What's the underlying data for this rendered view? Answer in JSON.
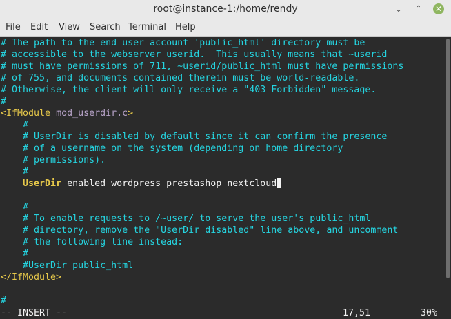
{
  "window": {
    "title": "root@instance-1:/home/rendy",
    "minimize_glyph": "⌄",
    "maximize_glyph": "⌃",
    "close_glyph": "✕"
  },
  "menu": [
    "File",
    "Edit",
    "View",
    "Search",
    "Terminal",
    "Help"
  ],
  "editor": {
    "lines": [
      "# The path to the end user account 'public_html' directory must be",
      "# accessible to the webserver userid.  This usually means that ~userid",
      "# must have permissions of 711, ~userid/public_html must have permissions",
      "# of 755, and documents contained therein must be world-readable.",
      "# Otherwise, the client will only receive a \"403 Forbidden\" message.",
      "#",
      "    #",
      "    # UserDir is disabled by default since it can confirm the presence",
      "    # of a username on the system (depending on home directory",
      "    # permissions).",
      "    #",
      "    #",
      "    # To enable requests to /~user/ to serve the user's public_html",
      "    # directory, remove the \"UserDir disabled\" line above, and uncomment",
      "    # the following line instead:",
      "    #",
      "    #UserDir public_html",
      "#"
    ],
    "ifmodule_open_bracket": "<IfModule",
    "ifmodule_name": "mod_userdir.c",
    "ifmodule_close_bracket": ">",
    "ifmodule_close": "</IfModule>",
    "userdir_keyword": "UserDir",
    "userdir_value": " enabled wordpress prestashop nextcloud",
    "indent": "    "
  },
  "status": {
    "mode": "-- INSERT --",
    "position": "17,51",
    "percent": "30%"
  },
  "colors": {
    "comment": "#25d4e0",
    "keyword": "#e6c84a",
    "background": "#2b2b2b",
    "text": "#f2f2f2"
  }
}
